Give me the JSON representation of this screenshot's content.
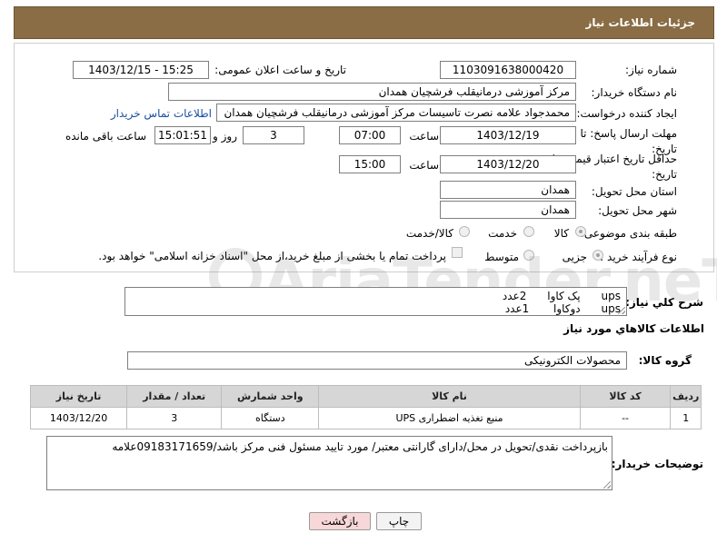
{
  "header": {
    "title": "جزئیات اطلاعات نیاز"
  },
  "fields": {
    "need_number_label": "شماره نیاز:",
    "need_number": "1103091638000420",
    "announce_label": "تاریخ و ساعت اعلان عمومی:",
    "announce_value": "1403/12/15 - 15:25",
    "buyer_org_label": "نام دستگاه خریدار:",
    "buyer_org": "مرکز آموزشی درمانیقلب فرشچیان همدان",
    "creator_label": "ایجاد کننده درخواست:",
    "creator": "محمدجواد علامه نصرت تاسیسات مرکز آموزشی درمانیقلب فرشچیان همدان",
    "contact_link": "اطلاعات تماس خریدار",
    "deadline_label": "مهلت ارسال پاسخ: تا تاریخ:",
    "deadline_date": "1403/12/19",
    "time_label": "ساعت",
    "deadline_time": "07:00",
    "days_value": "3",
    "days_label": "روز و",
    "remaining_time": "15:01:51",
    "remaining_label": "ساعت باقی مانده",
    "validity_label": "حداقل تاریخ اعتبار قیمت: تا تاریخ:",
    "validity_date": "1403/12/20",
    "validity_time_label": "ساعت",
    "validity_time": "15:00",
    "province_label": "استان محل تحویل:",
    "province": "همدان",
    "city_label": "شهر محل تحویل:",
    "city": "همدان",
    "category_label": "طبقه بندی موضوعی:",
    "category_options": [
      "کالا",
      "خدمت",
      "کالا/خدمت"
    ],
    "process_label": "نوع فرآیند خرید :",
    "process_options": [
      "جزیی",
      "متوسط"
    ],
    "payment_note": "پرداخت تمام یا بخشی از مبلغ خرید،از محل \"اسناد خزانه اسلامی\" خواهد بود."
  },
  "description": {
    "label": "شرح کلي نياز:",
    "line1": "ups      پک کاوا      2عدد",
    "line2": "ups      دوکاوا       1عدد"
  },
  "goods_section": {
    "title": "اطلاعات کالاهاي مورد نياز",
    "group_label": "گروه کالا:",
    "group_value": "محصولات الکترونیکی"
  },
  "table": {
    "headers": [
      "ردیف",
      "کد کالا",
      "نام کالا",
      "واحد شمارش",
      "تعداد / مقدار",
      "تاریخ نیاز"
    ],
    "rows": [
      [
        "1",
        "--",
        "منبع تغذیه اضطراری UPS",
        "دستگاه",
        "3",
        "1403/12/20"
      ]
    ]
  },
  "buyer_notes": {
    "label": "توضیحات خریدار:",
    "text": "بازپرداخت نقدی/تحویل در محل/دارای گارانتی معتبر/ مورد تایید مسئول فنی مرکز باشد/09183171659علامه"
  },
  "buttons": {
    "print": "چاپ",
    "back": "بازگشت"
  },
  "watermark": "AriaTender.neT",
  "colors": {
    "header_bg": "#8a6d44",
    "link": "#1a4fa3",
    "back_button": "#f7d7d7"
  }
}
